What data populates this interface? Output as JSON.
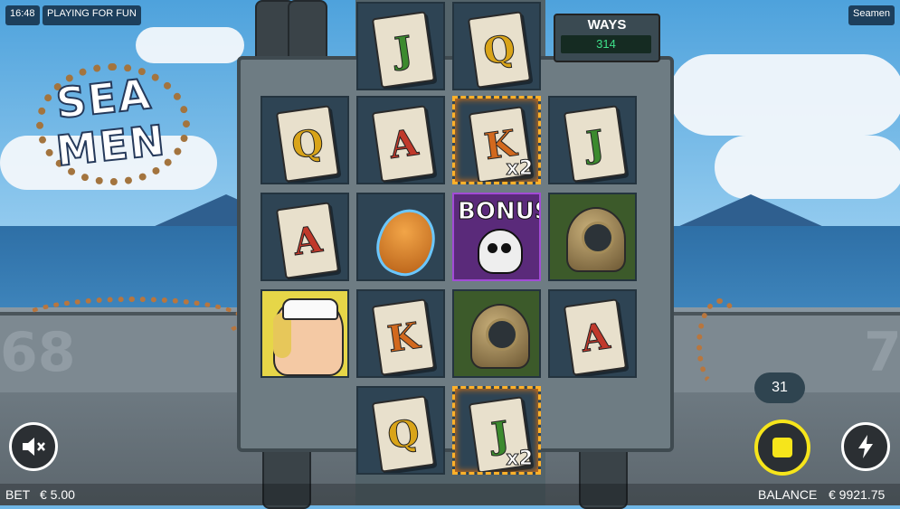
{
  "topbar": {
    "time": "16:48",
    "mode": "PLAYING FOR FUN",
    "game_name": "Seamen"
  },
  "logo": {
    "line1": "SEA",
    "line2": "MEN"
  },
  "ways": {
    "label": "WAYS",
    "value": "314"
  },
  "background": {
    "hull_left": "68",
    "hull_right": "7"
  },
  "reels": [
    {
      "col": 0,
      "cells": [
        {
          "row": 1,
          "type": "card",
          "rank": "Q",
          "color": "#d9a419"
        },
        {
          "row": 2,
          "type": "card",
          "rank": "A",
          "color": "#c0392b"
        },
        {
          "row": 3,
          "type": "sailor-girl"
        }
      ]
    },
    {
      "col": 1,
      "cells": [
        {
          "row": 0,
          "type": "card",
          "rank": "J",
          "color": "#3c8a2e"
        },
        {
          "row": 1,
          "type": "card",
          "rank": "A",
          "color": "#c0392b"
        },
        {
          "row": 2,
          "type": "coconut"
        },
        {
          "row": 3,
          "type": "card",
          "rank": "K",
          "color": "#d2691e"
        },
        {
          "row": 4,
          "type": "card",
          "rank": "Q",
          "color": "#d9a419"
        }
      ]
    },
    {
      "col": 2,
      "cells": [
        {
          "row": 0,
          "type": "card",
          "rank": "Q",
          "color": "#d9a419"
        },
        {
          "row": 1,
          "type": "card",
          "rank": "K",
          "color": "#d2691e",
          "multiplier": "x2"
        },
        {
          "row": 2,
          "type": "bonus",
          "label": "BONUS"
        },
        {
          "row": 3,
          "type": "diver-helmet"
        },
        {
          "row": 4,
          "type": "card",
          "rank": "J",
          "color": "#3c8a2e",
          "multiplier": "x2"
        }
      ]
    },
    {
      "col": 3,
      "cells": [
        {
          "row": 1,
          "type": "card",
          "rank": "J",
          "color": "#3c8a2e"
        },
        {
          "row": 2,
          "type": "diver-helmet"
        },
        {
          "row": 3,
          "type": "card",
          "rank": "A",
          "color": "#c0392b"
        }
      ]
    }
  ],
  "autoplay": {
    "count": "31"
  },
  "buttons": {
    "sound_icon": "speaker-mute-icon",
    "stop_icon": "stop-icon",
    "turbo_icon": "lightning-icon"
  },
  "footer": {
    "bet_label": "BET",
    "bet_value": "€ 5.00",
    "balance_label": "BALANCE",
    "balance_value": "€ 9921.75"
  },
  "colors": {
    "accent": "#f6e51b",
    "win_frame": "#ffb12a",
    "ways_value": "#3ee08a"
  }
}
